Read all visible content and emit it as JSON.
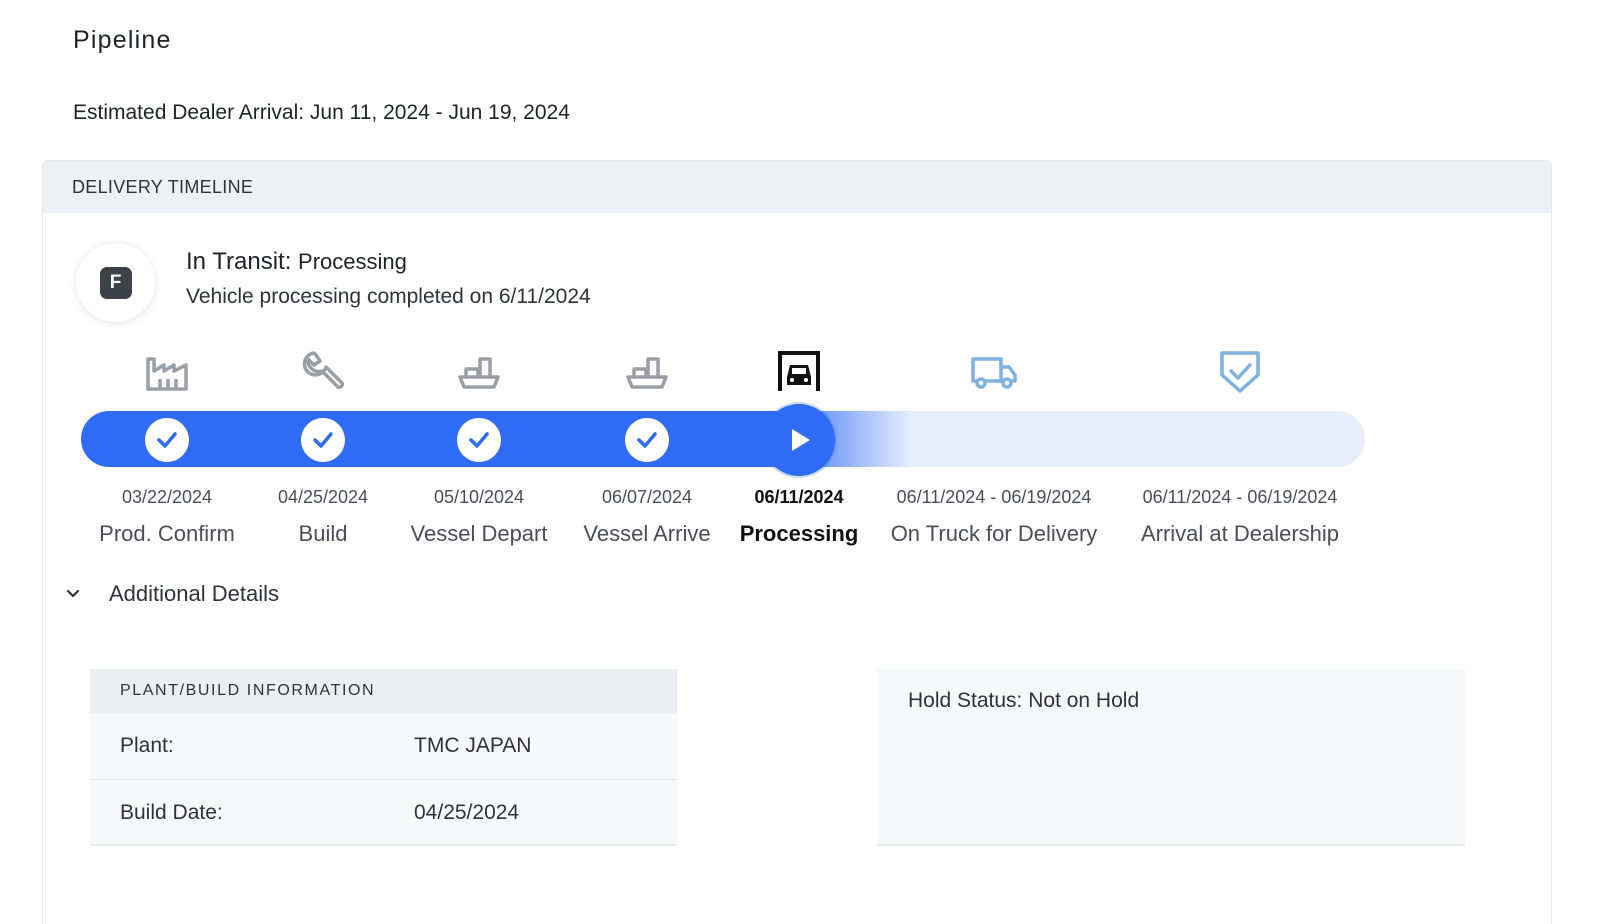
{
  "page": {
    "title": "Pipeline",
    "eta": "Estimated Dealer Arrival: Jun 11, 2024 - Jun 19, 2024"
  },
  "timeline": {
    "header": "DELIVERY TIMELINE",
    "avatar_letter": "F",
    "status_label": "In Transit:",
    "status_value": "Processing",
    "status_sub": "Vehicle processing completed on 6/11/2024",
    "stages": [
      {
        "icon": "factory-icon",
        "date": "03/22/2024",
        "name": "Prod. Confirm",
        "state": "completed"
      },
      {
        "icon": "wrench-icon",
        "date": "04/25/2024",
        "name": "Build",
        "state": "completed"
      },
      {
        "icon": "ship-icon",
        "date": "05/10/2024",
        "name": "Vessel Depart",
        "state": "completed"
      },
      {
        "icon": "ship-icon",
        "date": "06/07/2024",
        "name": "Vessel Arrive",
        "state": "completed"
      },
      {
        "icon": "car-garage-icon",
        "date": "06/11/2024",
        "name": "Processing",
        "state": "current"
      },
      {
        "icon": "truck-icon",
        "date": "06/11/2024 - 06/19/2024",
        "name": "On Truck for Delivery",
        "state": "upcoming"
      },
      {
        "icon": "shield-check-icon",
        "date": "06/11/2024 - 06/19/2024",
        "name": "Arrival at Dealership",
        "state": "upcoming"
      }
    ]
  },
  "details": {
    "toggle_label": "Additional Details",
    "plant": {
      "header": "PLANT/BUILD INFORMATION",
      "rows": [
        {
          "key": "Plant:",
          "value": "TMC JAPAN"
        },
        {
          "key": "Build Date:",
          "value": "04/25/2024"
        }
      ]
    },
    "hold_status": "Hold Status: Not on Hold"
  },
  "colors": {
    "accent": "#2f6bf5",
    "track_upcoming": "#e6eefc",
    "icon_done": "#9a9ea5",
    "icon_upcoming": "#7fb2e0"
  }
}
